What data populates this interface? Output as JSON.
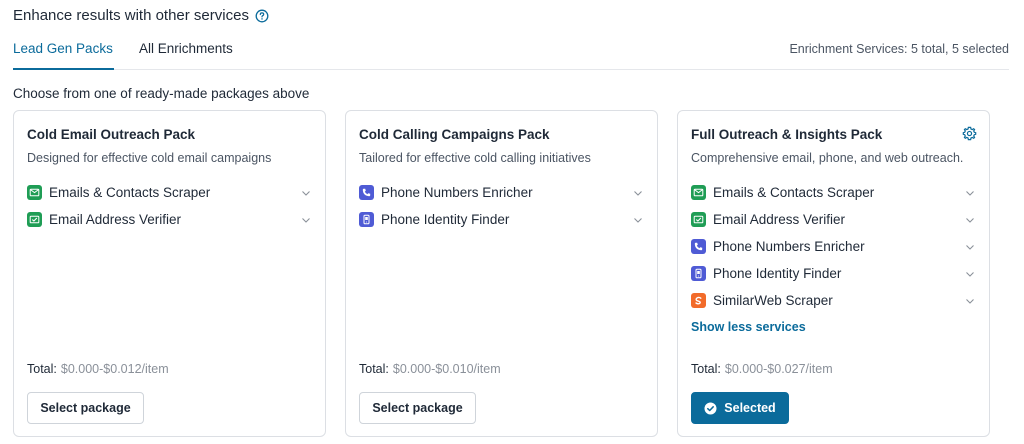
{
  "header": {
    "title": "Enhance results with other services",
    "help_icon": "question-circle-icon"
  },
  "tabs": [
    {
      "label": "Lead Gen Packs",
      "active": true
    },
    {
      "label": "All Enrichments",
      "active": false
    }
  ],
  "enrichment_summary": "Enrichment Services: 5 total, 5 selected",
  "choose_text": "Choose from one of ready-made packages above",
  "colors": {
    "accent": "#0b6b9b",
    "green_icon": "#1f9d55",
    "blue_icon": "#4f5bd5",
    "orange_icon": "#f26b2a"
  },
  "packs": [
    {
      "title": "Cold Email Outreach Pack",
      "description": "Designed for effective cold email campaigns",
      "services": [
        {
          "label": "Emails & Contacts Scraper",
          "icon": "contact-card-icon"
        },
        {
          "label": "Email Address Verifier",
          "icon": "email-verify-icon"
        }
      ],
      "total_label": "Total:",
      "total_value": "$0.000-$0.012/item",
      "button_label": "Select package"
    },
    {
      "title": "Cold Calling Campaigns Pack",
      "description": "Tailored for effective cold calling initiatives",
      "services": [
        {
          "label": "Phone Numbers Enricher",
          "icon": "phone-icon"
        },
        {
          "label": "Phone Identity Finder",
          "icon": "mobile-phone-icon"
        }
      ],
      "total_label": "Total:",
      "total_value": "$0.000-$0.010/item",
      "button_label": "Select package"
    },
    {
      "title": "Full Outreach & Insights Pack",
      "description": "Comprehensive email, phone, and web outreach.",
      "services": [
        {
          "label": "Emails & Contacts Scraper",
          "icon": "contact-card-icon"
        },
        {
          "label": "Email Address Verifier",
          "icon": "email-verify-icon"
        },
        {
          "label": "Phone Numbers Enricher",
          "icon": "phone-icon"
        },
        {
          "label": "Phone Identity Finder",
          "icon": "mobile-phone-icon"
        },
        {
          "label": "SimilarWeb Scraper",
          "icon": "similarweb-icon"
        }
      ],
      "show_less_label": "Show less services",
      "total_label": "Total:",
      "total_value": "$0.000-$0.027/item",
      "button_label": "Selected",
      "selected": true
    }
  ]
}
